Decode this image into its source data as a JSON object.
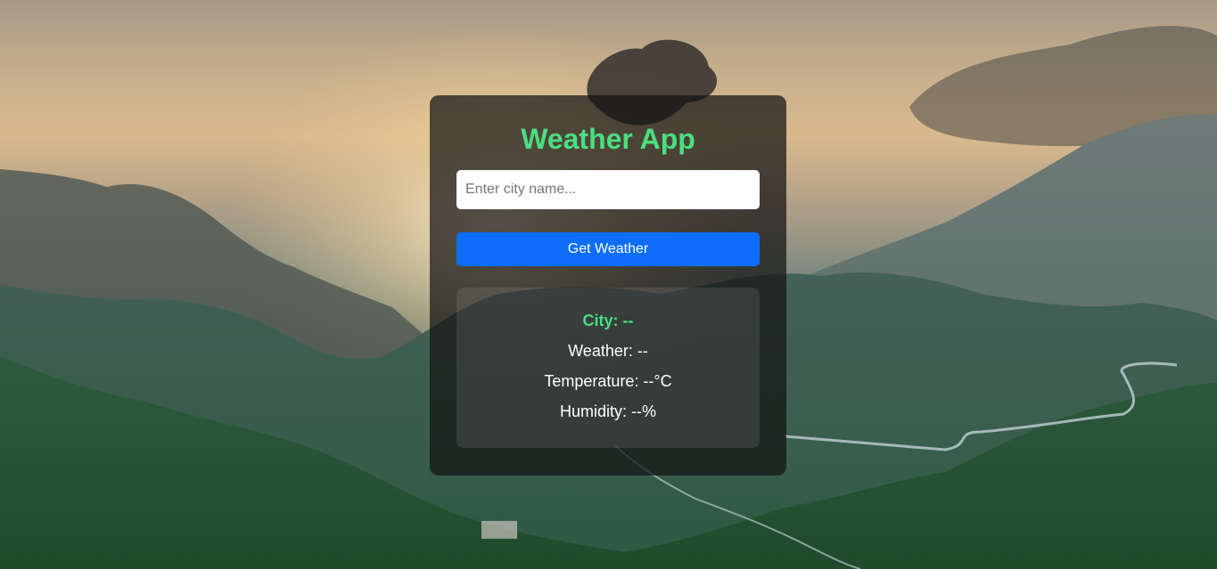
{
  "app": {
    "title": "Weather App"
  },
  "search": {
    "placeholder": "Enter city name...",
    "value": "",
    "button_label": "Get Weather"
  },
  "result": {
    "city": "City: --",
    "weather": "Weather: --",
    "temperature": "Temperature: --°C",
    "humidity": "Humidity: --%"
  },
  "colors": {
    "title": "#4ade80",
    "button": "#0d6efd",
    "card_background": "rgba(20,20,20,0.72)"
  }
}
